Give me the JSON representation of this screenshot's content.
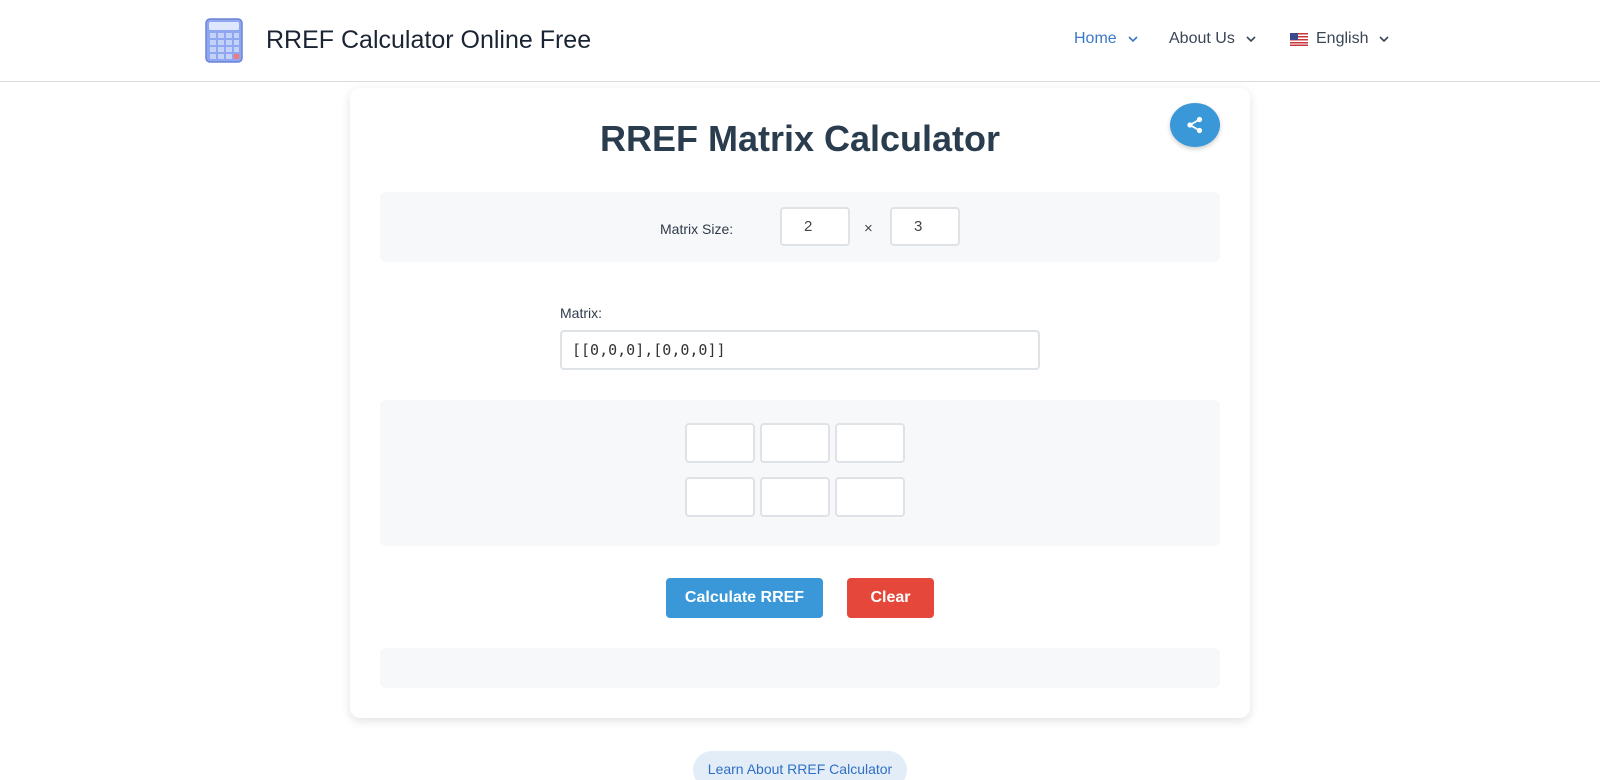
{
  "header": {
    "site_title": "RREF Calculator Online Free",
    "logo_icon": "calculator-icon",
    "nav": {
      "home": "Home",
      "about": "About Us",
      "language": "English"
    }
  },
  "calculator": {
    "title": "RREF Matrix Calculator",
    "share_icon": "share-icon",
    "size_label": "Matrix Size:",
    "rows": "2",
    "times": "×",
    "cols": "3",
    "matrix_label": "Matrix:",
    "matrix_value": "[[0,0,0],[0,0,0]]",
    "cells": [
      [
        "",
        "",
        ""
      ],
      [
        "",
        "",
        ""
      ]
    ],
    "calculate_label": "Calculate RREF",
    "clear_label": "Clear"
  },
  "footer": {
    "learn_link": "Learn About RREF Calculator"
  },
  "colors": {
    "accent_blue": "#3a97d8",
    "clear_red": "#e5483b",
    "nav_active": "#3b78c8"
  }
}
